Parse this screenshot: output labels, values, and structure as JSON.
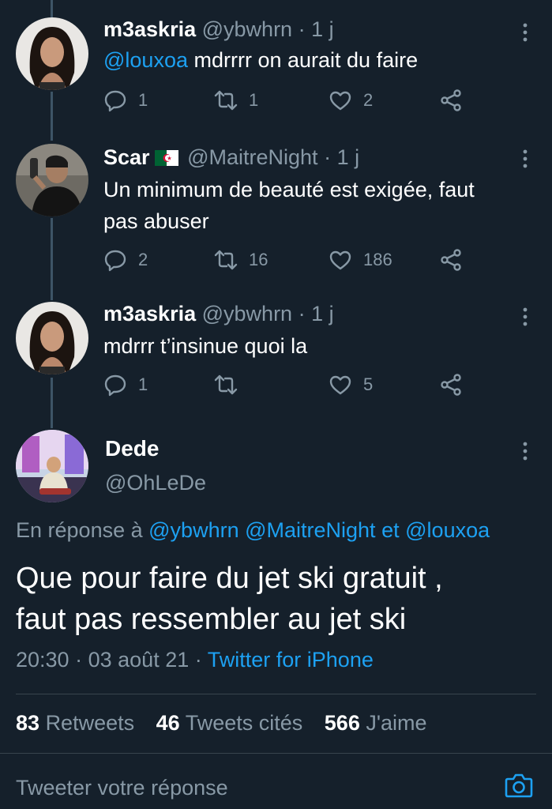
{
  "replies": [
    {
      "name": "m3askria",
      "handle": "@ybwhrn",
      "sep": "·",
      "time": "1 j",
      "mention": "@louxoa",
      "text": " mdrrrr on aurait du faire",
      "replies": "1",
      "retweets": "1",
      "likes": "2"
    },
    {
      "name": "Scar",
      "handle": "@MaitreNight",
      "sep": "·",
      "time": "1 j",
      "text_line1": "Un minimum de beauté est exigée, faut",
      "text_line2": "pas abuser",
      "replies": "2",
      "retweets": "16",
      "likes": "186"
    },
    {
      "name": "m3askria",
      "handle": "@ybwhrn",
      "sep": "·",
      "time": "1 j",
      "text": "mdrrr t’insinue quoi la",
      "replies": "1",
      "retweets": "",
      "likes": "5"
    }
  ],
  "main": {
    "name": "Dede",
    "handle": "@OhLeDe",
    "reply_prefix": "En réponse à",
    "reply_mention1": "@ybwhrn",
    "reply_mention2": "@MaitreNight",
    "reply_and": "et",
    "reply_mention3": "@louxoa",
    "text_line1": "Que pour faire du jet ski gratuit ,",
    "text_line2": "faut pas ressembler au jet ski",
    "time": "20:30",
    "date_sep": "·",
    "date": "03 août 21",
    "client_sep": "·",
    "client": "Twitter for iPhone",
    "retweets_count": "83",
    "retweets_label": "Retweets",
    "quotes_count": "46",
    "quotes_label": "Tweets cités",
    "likes_count": "566",
    "likes_label": "J'aime"
  },
  "compose": {
    "placeholder": "Tweeter votre réponse"
  },
  "colors": {
    "background": "#15202b",
    "secondary_text": "#8899a6",
    "accent": "#1da1f2",
    "divider": "#38444d"
  },
  "icons": [
    "reply-icon",
    "retweet-icon",
    "like-icon",
    "share-icon",
    "more-icon",
    "camera-icon",
    "algeria-flag-icon"
  ]
}
